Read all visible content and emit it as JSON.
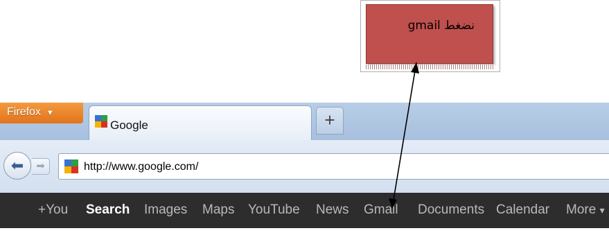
{
  "annotation": {
    "text": "نضغط gmail"
  },
  "browser": {
    "menu_button": "Firefox",
    "menu_caret": "▼",
    "tab_title": "Google",
    "new_tab": "+",
    "url": "http://www.google.com/",
    "back_glyph": "⬅",
    "forward_glyph": "➡"
  },
  "google_bar": {
    "items": [
      "+You",
      "Search",
      "Images",
      "Maps",
      "YouTube",
      "News",
      "Gmail",
      "Documents",
      "Calendar",
      "More"
    ],
    "active": "Search",
    "more_caret": "▾"
  },
  "colors": {
    "callout": "#c0504d",
    "firefox_button": "#e8812a",
    "google_bar": "#2d2d2d"
  }
}
